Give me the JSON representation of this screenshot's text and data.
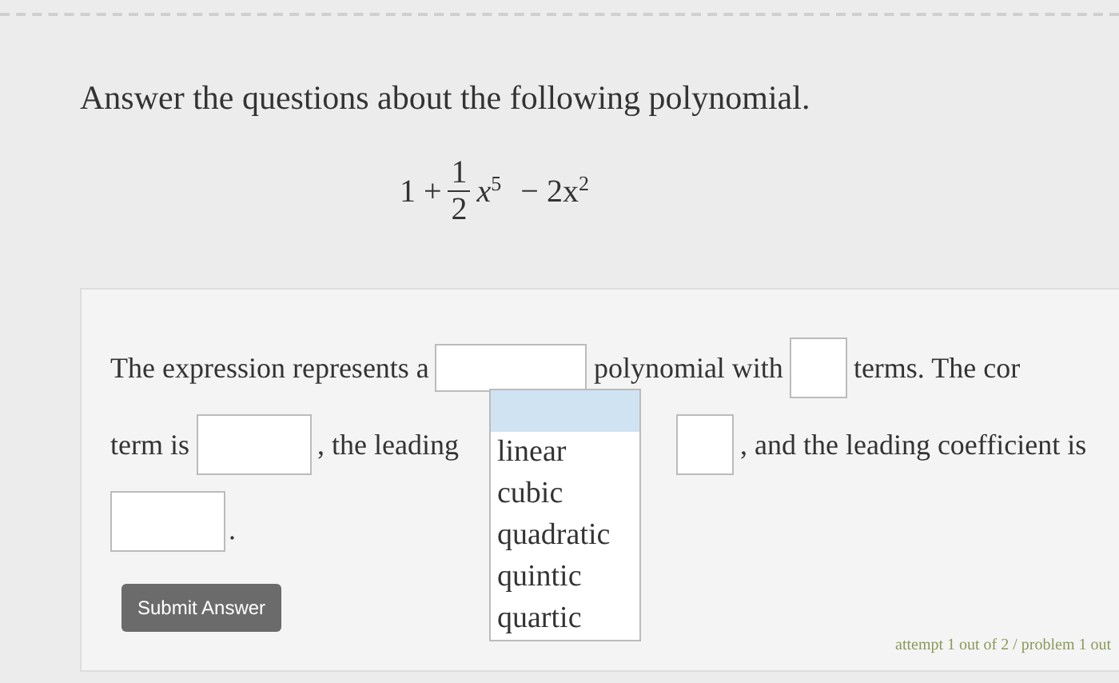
{
  "heading": "Answer the questions about the following polynomial.",
  "expression": {
    "lead": "1 +",
    "numerator": "1",
    "denominator": "2",
    "base": "x",
    "power": "5",
    "tail": "− 2x",
    "tail_power": "2"
  },
  "question": {
    "line1_start": "The expression represents a",
    "line1_mid": "polynomial with",
    "line1_end": "terms. The cor",
    "line2_start": "term is",
    "line2_mid": ", the leading",
    "line2_end": ", and the leading coefficient is",
    "line3_end": "."
  },
  "dropdown": {
    "expanded": true,
    "options": [
      {
        "selected": true
      },
      {
        "label": "linear",
        "selected": false
      },
      {
        "label": "cubic",
        "selected": false
      },
      {
        "label": "quadratic",
        "selected": false
      },
      {
        "label": "quintic",
        "selected": false
      },
      {
        "label": "quartic",
        "selected": false
      }
    ]
  },
  "submit_button": "Submit Answer",
  "footer": "attempt 1 out of 2 / problem 1 out"
}
